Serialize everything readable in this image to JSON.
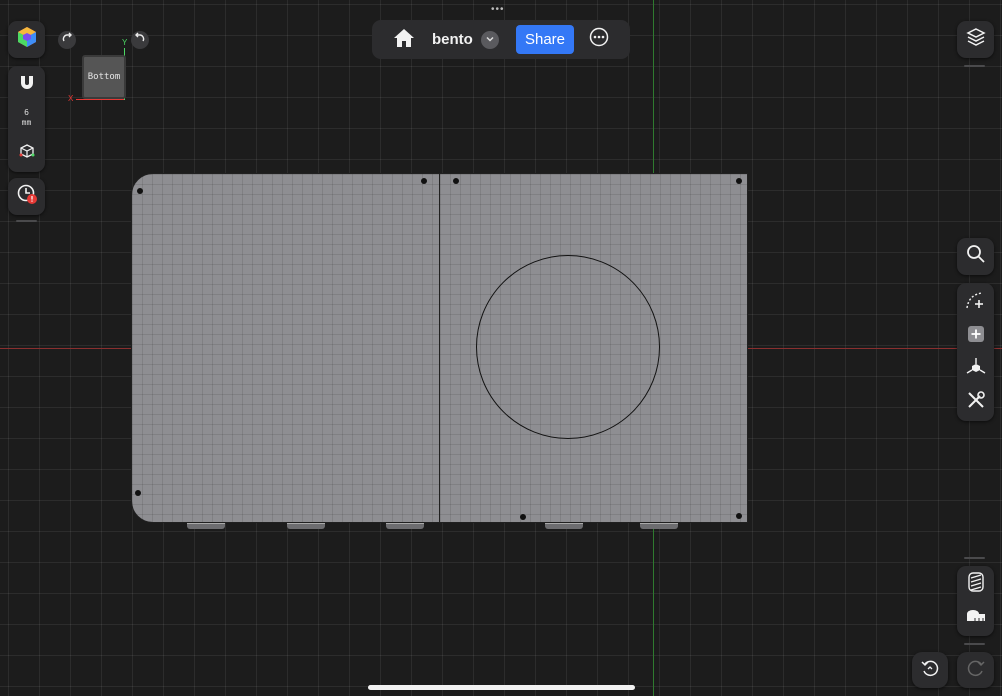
{
  "topbar": {
    "drag_dots": "•••",
    "doc_name": "bento",
    "share_label": "Share"
  },
  "left_toolbar": {
    "snap_value": "6",
    "snap_unit": "mm"
  },
  "viewcube": {
    "face_label": "Bottom",
    "axis_x": "X",
    "axis_y": "Y"
  },
  "icons": {
    "app": "app-cube-icon",
    "magnet": "magnet-icon",
    "snap_cube": "snap-cube-icon",
    "history": "history-clock-icon",
    "rotate_cw": "rotate-cw-icon",
    "rotate_ccw": "rotate-ccw-icon",
    "home": "home-icon",
    "dropdown": "chevron-down-icon",
    "more": "more-icon",
    "layers": "layers-icon",
    "search": "search-icon",
    "sketch": "sketch-curve-icon",
    "add_primitive": "add-icon",
    "transform": "transform-icon",
    "tools": "tools-icon",
    "texture": "texture-icon",
    "measure": "measure-tape-icon",
    "undo": "undo-icon",
    "redo": "redo-icon"
  },
  "colors": {
    "background": "#1c1c1c",
    "accent": "#3478f6",
    "plate": "#8e8e92",
    "axis_y": "#2f7a2f",
    "axis_x": "#8a2f2f",
    "warning": "#e53935"
  }
}
